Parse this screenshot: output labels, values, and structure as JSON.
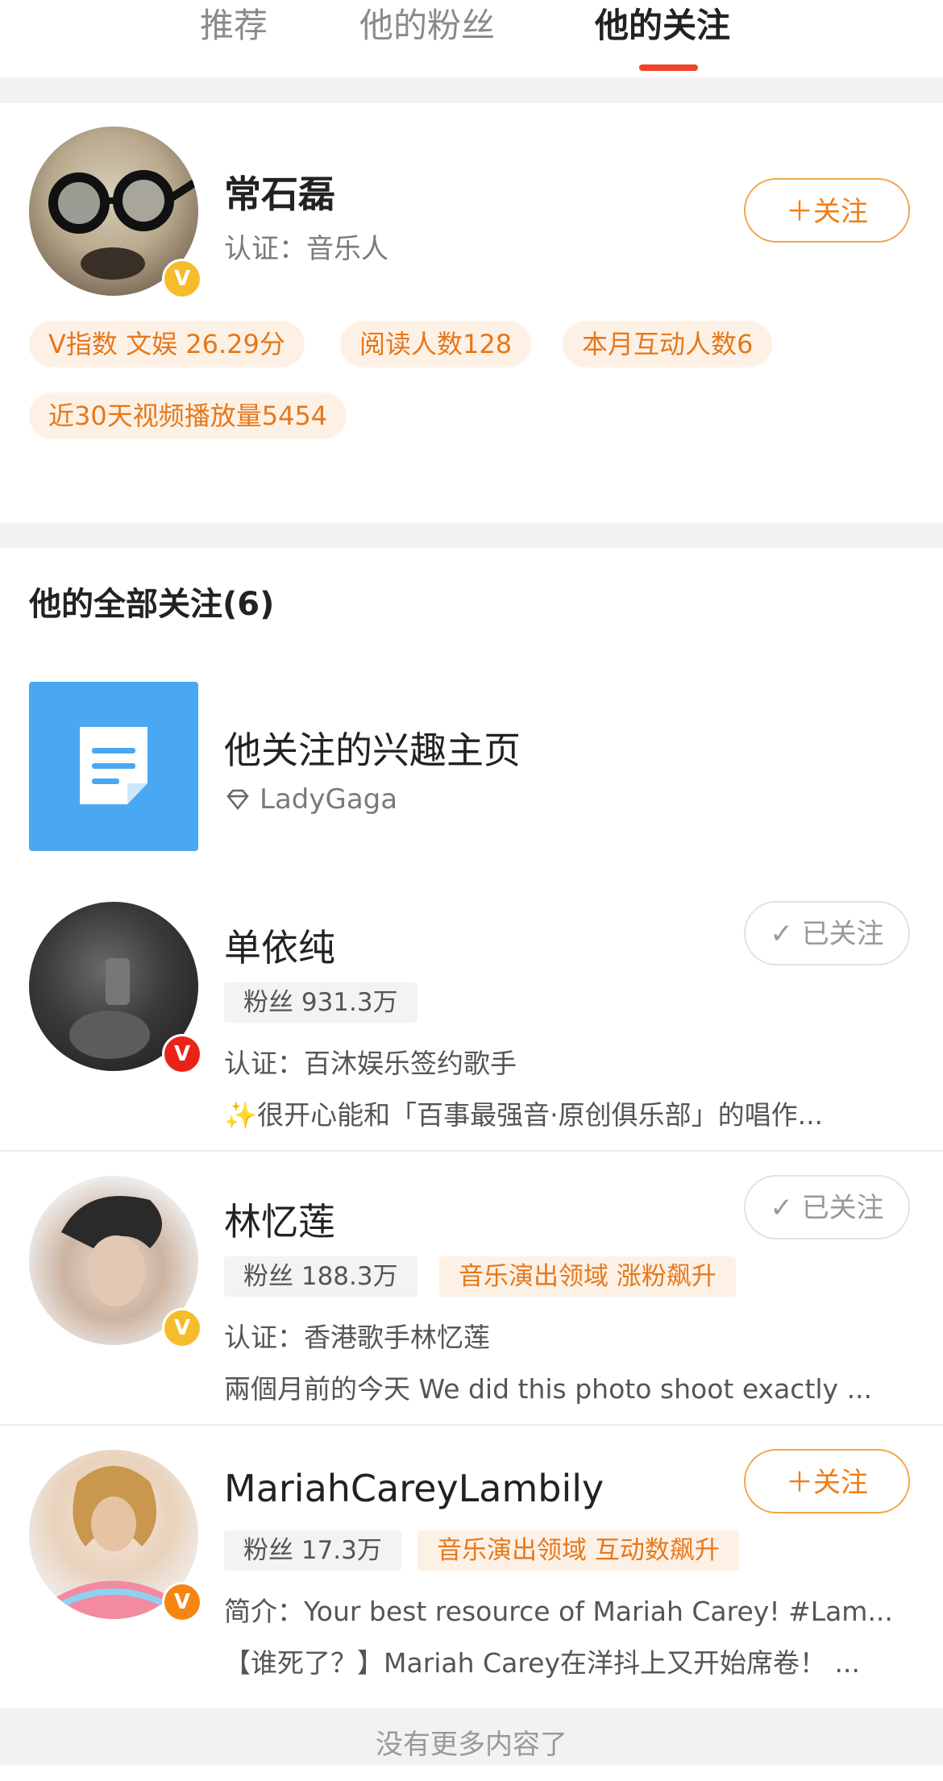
{
  "tabs": [
    {
      "label": "推荐",
      "active": false
    },
    {
      "label": "他的粉丝",
      "active": false
    },
    {
      "label": "他的关注",
      "active": true
    }
  ],
  "profile": {
    "name": "常石磊",
    "verification": "认证：音乐人",
    "follow_label": "关注",
    "badge": "V",
    "pills": [
      "V指数 文娱 26.29分",
      "阅读人数128",
      "本月互动人数6",
      "近30天视频播放量5454"
    ]
  },
  "following": {
    "section_title": "他的全部关注(6)",
    "interest": {
      "title": "他关注的兴趣主页",
      "item": "LadyGaga",
      "icon": "document-icon",
      "sub_icon": "diamond-icon"
    },
    "users": [
      {
        "name": "单依纯",
        "button": "已关注",
        "followed": true,
        "fans": "粉丝 931.3万",
        "tag": "",
        "line1": "认证：百沐娱乐签约歌手",
        "line2": "✨很开心能和「百事最强音·原创俱乐部」的唱作...",
        "badge": "V",
        "badge_color": "#e8231a"
      },
      {
        "name": "林忆莲",
        "button": "已关注",
        "followed": true,
        "fans": "粉丝 188.3万",
        "tag": "音乐演出领域 涨粉飙升",
        "line1": "认证：香港歌手林忆莲",
        "line2": "兩個月前的今天 We did this photo shoot exactly ...",
        "badge": "V",
        "badge_color": "#f5bd2c"
      },
      {
        "name": "MariahCareyLambily",
        "button": "关注",
        "followed": false,
        "fans": "粉丝 17.3万",
        "tag": "音乐演出领域 互动数飙升",
        "line1": "简介：Your best resource of Mariah Carey! #Lam...",
        "line2": "【谁死了？】Mariah Carey在洋抖上又开始席卷！ ...",
        "badge": "V",
        "badge_color": "#f78512"
      }
    ],
    "footer": "没有更多内容了"
  },
  "colors": {
    "accent": "#f07d17",
    "tab_indicator": "#ef4427",
    "interest_tile": "#4aa8f2"
  }
}
